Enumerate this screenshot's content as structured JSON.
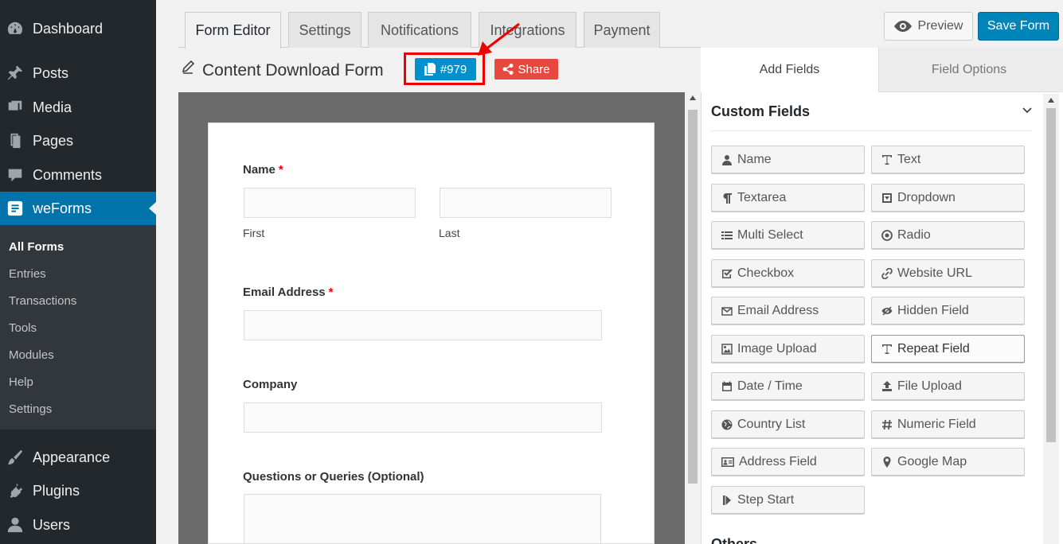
{
  "sidebar": {
    "items": [
      {
        "label": "Dashboard",
        "icon": "dashboard-icon"
      },
      {
        "label": "Posts",
        "icon": "pin-icon"
      },
      {
        "label": "Media",
        "icon": "media-icon"
      },
      {
        "label": "Pages",
        "icon": "pages-icon"
      },
      {
        "label": "Comments",
        "icon": "comments-icon"
      },
      {
        "label": "weForms",
        "icon": "weforms-icon"
      },
      {
        "label": "Appearance",
        "icon": "brush-icon"
      },
      {
        "label": "Plugins",
        "icon": "plugin-icon"
      },
      {
        "label": "Users",
        "icon": "user-icon"
      }
    ],
    "submenu": [
      "All Forms",
      "Entries",
      "Transactions",
      "Tools",
      "Modules",
      "Help",
      "Settings"
    ]
  },
  "tabs": [
    "Form Editor",
    "Settings",
    "Notifications",
    "Integrations",
    "Payment"
  ],
  "actions": {
    "preview": "Preview",
    "save": "Save Form"
  },
  "form": {
    "title": "Content Download Form",
    "id_label": "#979",
    "share_label": "Share",
    "fields": {
      "name_label": "Name",
      "required_mark": "*",
      "first": "First",
      "last": "Last",
      "email_label": "Email Address",
      "company_label": "Company",
      "questions_label": "Questions or Queries (Optional)"
    }
  },
  "panel": {
    "tabs": [
      "Add Fields",
      "Field Options"
    ],
    "section_title": "Custom Fields",
    "other_title": "Others",
    "buttons": [
      {
        "label": "Name",
        "icon": "user-icon"
      },
      {
        "label": "Text",
        "icon": "text-icon"
      },
      {
        "label": "Textarea",
        "icon": "paragraph-icon"
      },
      {
        "label": "Dropdown",
        "icon": "dropdown-icon"
      },
      {
        "label": "Multi Select",
        "icon": "list-icon"
      },
      {
        "label": "Radio",
        "icon": "radio-icon"
      },
      {
        "label": "Checkbox",
        "icon": "checkbox-icon"
      },
      {
        "label": "Website URL",
        "icon": "link-icon"
      },
      {
        "label": "Email Address",
        "icon": "envelope-icon"
      },
      {
        "label": "Hidden Field",
        "icon": "eye-slash-icon"
      },
      {
        "label": "Image Upload",
        "icon": "image-icon"
      },
      {
        "label": "Repeat Field",
        "icon": "text-icon"
      },
      {
        "label": "Date / Time",
        "icon": "calendar-icon"
      },
      {
        "label": "File Upload",
        "icon": "upload-icon"
      },
      {
        "label": "Country List",
        "icon": "globe-icon"
      },
      {
        "label": "Numeric Field",
        "icon": "hash-icon"
      },
      {
        "label": "Address Field",
        "icon": "address-card-icon"
      },
      {
        "label": "Google Map",
        "icon": "map-marker-icon"
      },
      {
        "label": "Step Start",
        "icon": "step-forward-icon"
      }
    ]
  },
  "colors": {
    "sidebar_bg": "#23282d",
    "submenu_bg": "#32373c",
    "active_blue": "#0073aa",
    "save_blue": "#0085ba",
    "share_red": "#e9483e",
    "annotation_red": "#ee0000"
  }
}
